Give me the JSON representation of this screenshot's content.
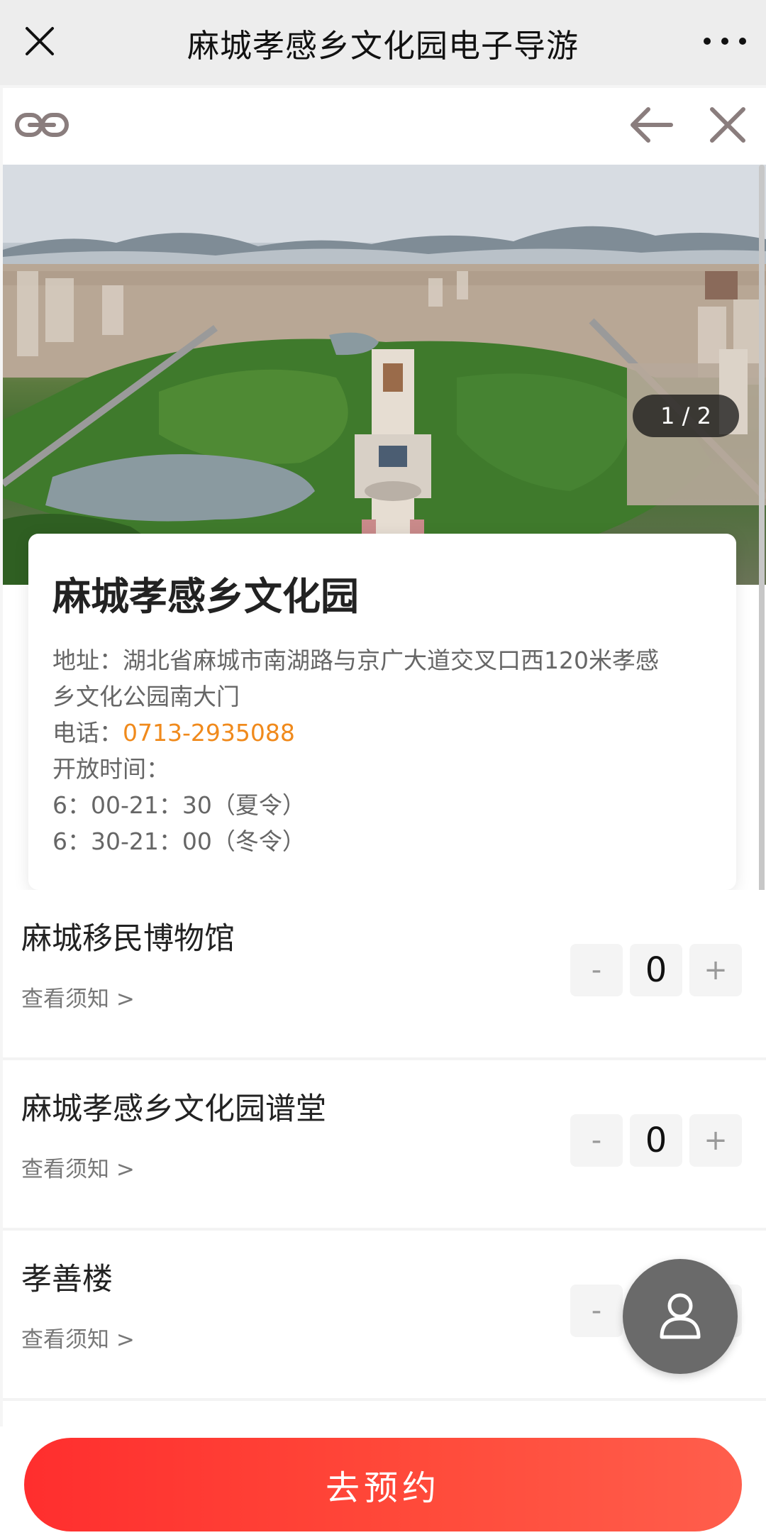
{
  "topbar": {
    "title": "麻城孝感乡文化园电子导游",
    "close_icon": "close-icon",
    "more_icon": "more-dots-icon"
  },
  "nav": {
    "link_icon": "link-icon",
    "back_icon": "arrow-left-icon",
    "close_icon": "close-icon"
  },
  "hero": {
    "pager": "1 / 2"
  },
  "info": {
    "title": "麻城孝感乡文化园",
    "address_line1": "地址：湖北省麻城市南湖路与京广大道交叉口西120米孝感",
    "address_line2": "乡文化公园南大门",
    "phone_label": "电话：",
    "phone": "0713-2935088",
    "hours_label": "开放时间：",
    "hours_summer": "6：00-21：30（夏令）",
    "hours_winter": "6：30-21：00（冬令）"
  },
  "tickets": [
    {
      "name": "麻城移民博物馆",
      "notice": "查看须知 >",
      "minus": "-",
      "count": "0",
      "plus": "+"
    },
    {
      "name": "麻城孝感乡文化园谱堂",
      "notice": "查看须知 >",
      "minus": "-",
      "count": "0",
      "plus": "+"
    },
    {
      "name": "孝善楼",
      "notice": "查看须知 >",
      "minus": "-",
      "count": "",
      "plus": ""
    }
  ],
  "fab": {
    "icon": "user-icon"
  },
  "bottom": {
    "reserve_label": "去预约"
  },
  "colors": {
    "accent_red": "#ff3a32",
    "phone_orange": "#f08a1c"
  }
}
